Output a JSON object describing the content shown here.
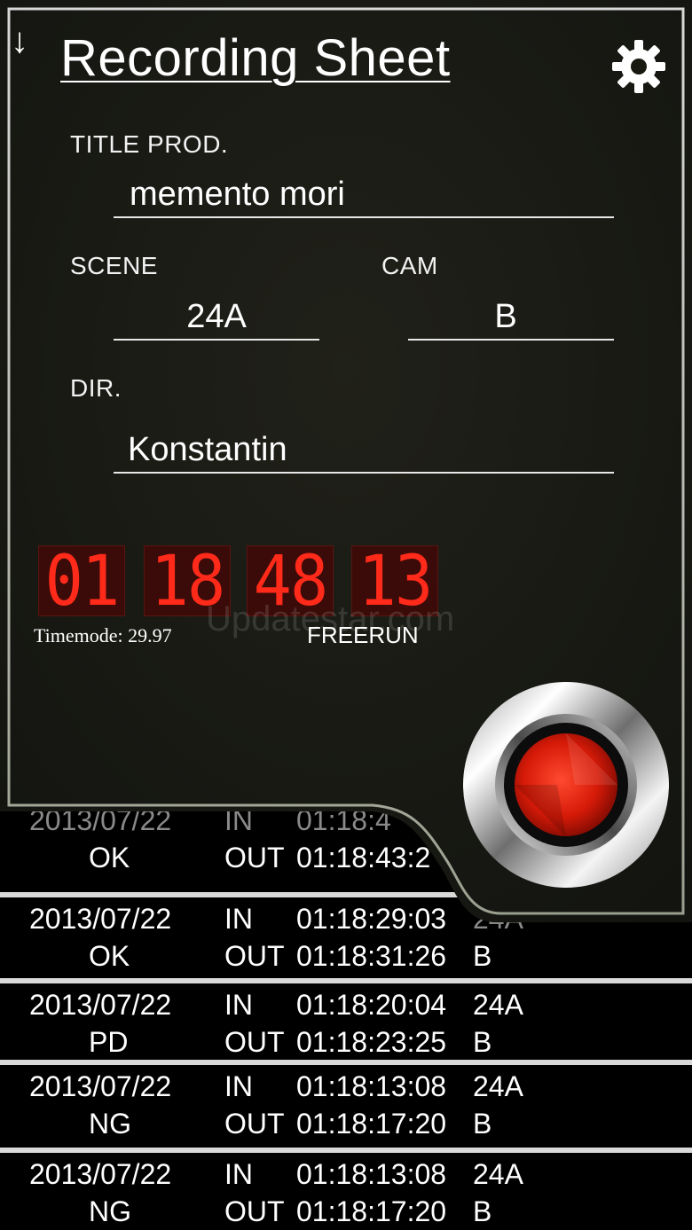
{
  "header": {
    "title": "Recording Sheet",
    "back_icon": "down-arrow-icon",
    "settings_icon": "gear-icon"
  },
  "sheet": {
    "title_prod_label": "TITLE PROD.",
    "title_prod_value": "memento mori",
    "scene_label": "SCENE",
    "scene_value": "24A",
    "cam_label": "CAM",
    "cam_value": "B",
    "dir_label": "DIR.",
    "dir_value": "Konstantin"
  },
  "timecode": {
    "hours": "01",
    "minutes": "18",
    "seconds": "48",
    "frames": "13",
    "timemode": "Timemode: 29.97",
    "run_mode": "FREERUN",
    "digit_color": "#ff2a1a"
  },
  "watermark": "Updatestar.com",
  "record_button": {
    "icon": "record-icon",
    "color": "#e0200f"
  },
  "log": [
    {
      "date": "2013/07/22",
      "in_label": "IN",
      "in_time": "01:18:4",
      "status": "OK",
      "out_label": "OUT",
      "out_time": "01:18:43:2",
      "scene": "",
      "cam": ""
    },
    {
      "date": "2013/07/22",
      "in_label": "IN",
      "in_time": "01:18:29:03",
      "status": "OK",
      "out_label": "OUT",
      "out_time": "01:18:31:26",
      "scene": "24A",
      "cam": "B"
    },
    {
      "date": "2013/07/22",
      "in_label": "IN",
      "in_time": "01:18:20:04",
      "status": "PD",
      "out_label": "OUT",
      "out_time": "01:18:23:25",
      "scene": "24A",
      "cam": "B"
    },
    {
      "date": "2013/07/22",
      "in_label": "IN",
      "in_time": "01:18:13:08",
      "status": "NG",
      "out_label": "OUT",
      "out_time": "01:18:17:20",
      "scene": "24A",
      "cam": "B"
    },
    {
      "date": "2013/07/22",
      "in_label": "IN",
      "in_time": "01:18:13:08",
      "status": "NG",
      "out_label": "OUT",
      "out_time": "01:18:17:20",
      "scene": "24A",
      "cam": "B"
    }
  ]
}
